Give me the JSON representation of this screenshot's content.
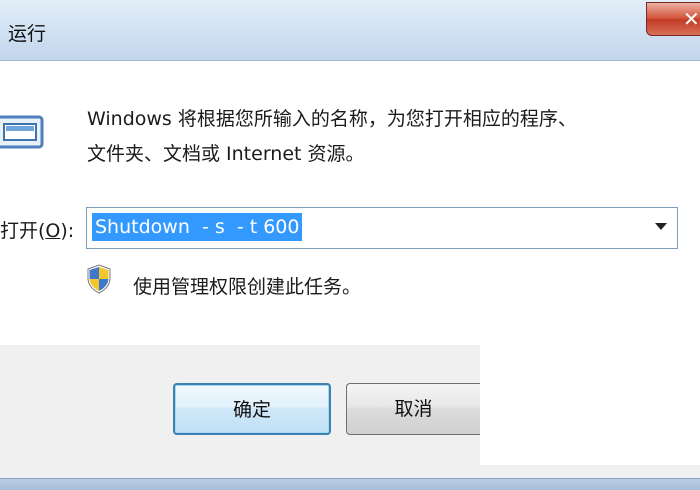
{
  "window": {
    "title": "运行",
    "close_glyph": "✕"
  },
  "description": {
    "line1": "Windows 将根据您所输入的名称，为您打开相应的程序、",
    "line2": "文件夹、文档或 Internet 资源。"
  },
  "open_field": {
    "label_prefix": "打开(",
    "label_hotkey": "O",
    "label_suffix": "):",
    "value": "Shutdown  - s  - t 600"
  },
  "admin_note": "使用管理权限创建此任务。",
  "buttons": {
    "ok": "确定",
    "cancel": "取消"
  },
  "icons": {
    "run": "run-window-icon",
    "shield": "uac-shield-icon",
    "dropdown": "chevron-down-icon"
  },
  "colors": {
    "selection": "#3399ff",
    "close_button": "#c23c24",
    "ok_border": "#3c7fb1"
  }
}
